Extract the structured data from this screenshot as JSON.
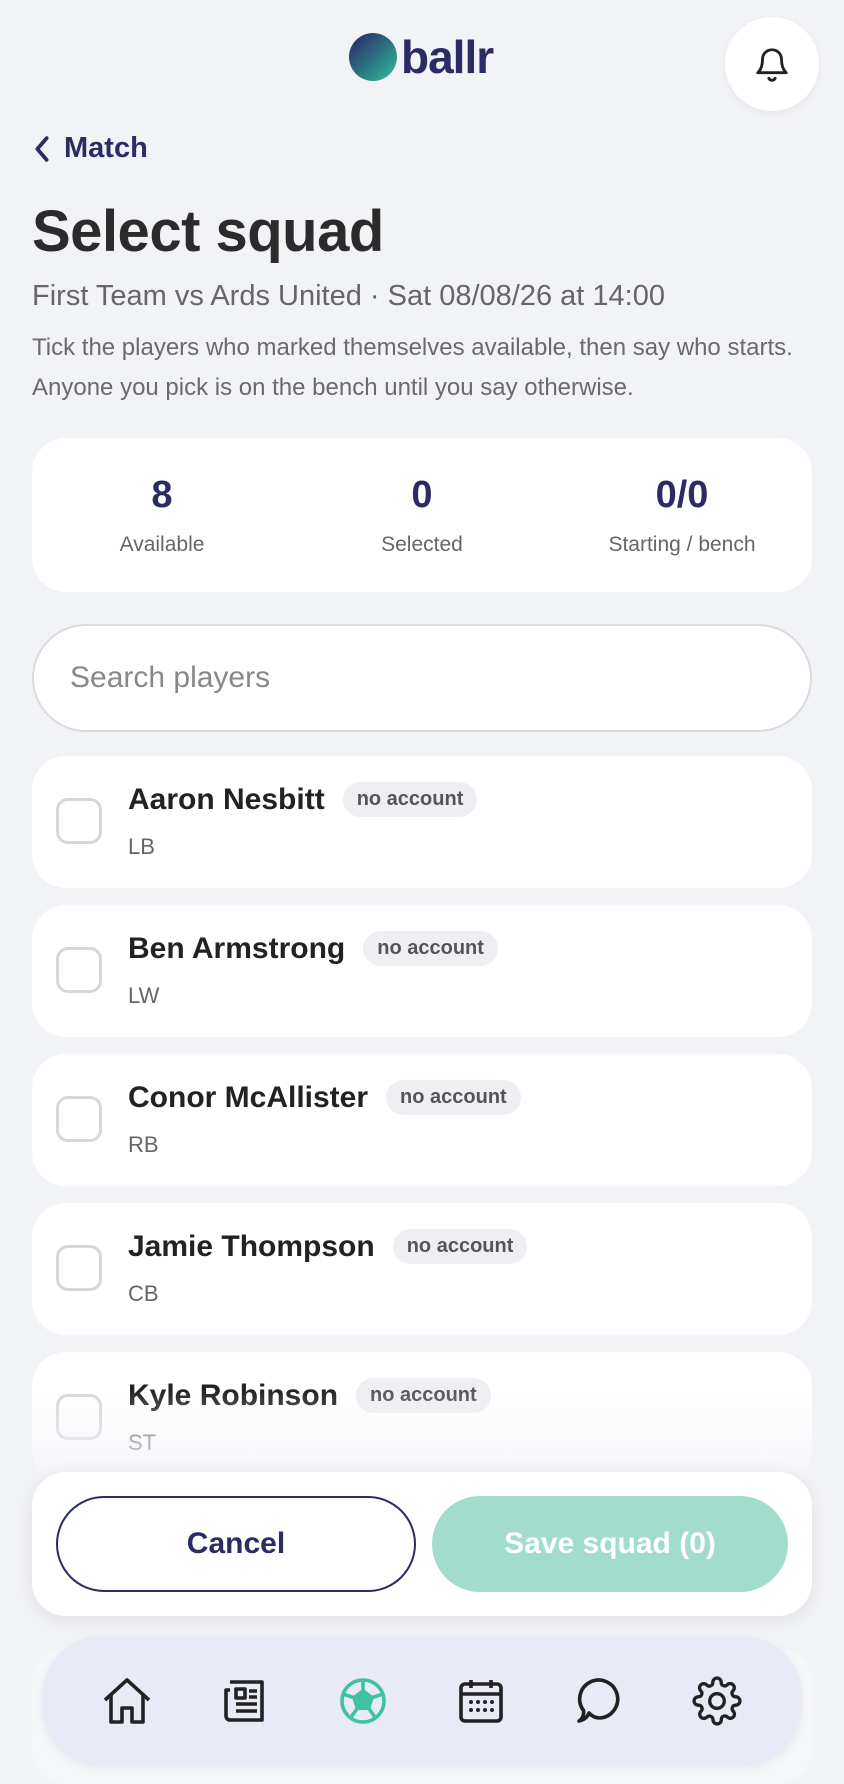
{
  "brand": {
    "name": "ballr"
  },
  "nav": {
    "back_label": "Match"
  },
  "page": {
    "title": "Select squad",
    "subtitle": "First Team vs Ards United · Sat 08/08/26 at 14:00",
    "hint": "Tick the players who marked themselves available, then say who starts. Anyone you pick is on the bench until you say otherwise."
  },
  "stats": {
    "available": {
      "value": "8",
      "label": "Available"
    },
    "selected": {
      "value": "0",
      "label": "Selected"
    },
    "starting_bench": {
      "value": "0/0",
      "label": "Starting / bench"
    }
  },
  "search": {
    "placeholder": "Search players",
    "value": ""
  },
  "players": [
    {
      "name": "Aaron Nesbitt",
      "badge": "no account",
      "position": "LB",
      "checked": false
    },
    {
      "name": "Ben Armstrong",
      "badge": "no account",
      "position": "LW",
      "checked": false
    },
    {
      "name": "Conor McAllister",
      "badge": "no account",
      "position": "RB",
      "checked": false
    },
    {
      "name": "Jamie Thompson",
      "badge": "no account",
      "position": "CB",
      "checked": false
    },
    {
      "name": "Kyle Robinson",
      "badge": "no account",
      "position": "ST",
      "checked": false
    }
  ],
  "actions": {
    "cancel_label": "Cancel",
    "save_label": "Save squad (0)"
  },
  "bottom_nav": {
    "items": [
      {
        "icon": "home-icon",
        "active": false
      },
      {
        "icon": "news-icon",
        "active": false
      },
      {
        "icon": "football-icon",
        "active": true
      },
      {
        "icon": "calendar-icon",
        "active": false
      },
      {
        "icon": "chat-icon",
        "active": false
      },
      {
        "icon": "settings-icon",
        "active": false
      }
    ]
  },
  "colors": {
    "brand": "#2a2c63",
    "accent": "#3ec2a2",
    "save_disabled": "#a2dccd",
    "background": "#f2f3f6"
  }
}
